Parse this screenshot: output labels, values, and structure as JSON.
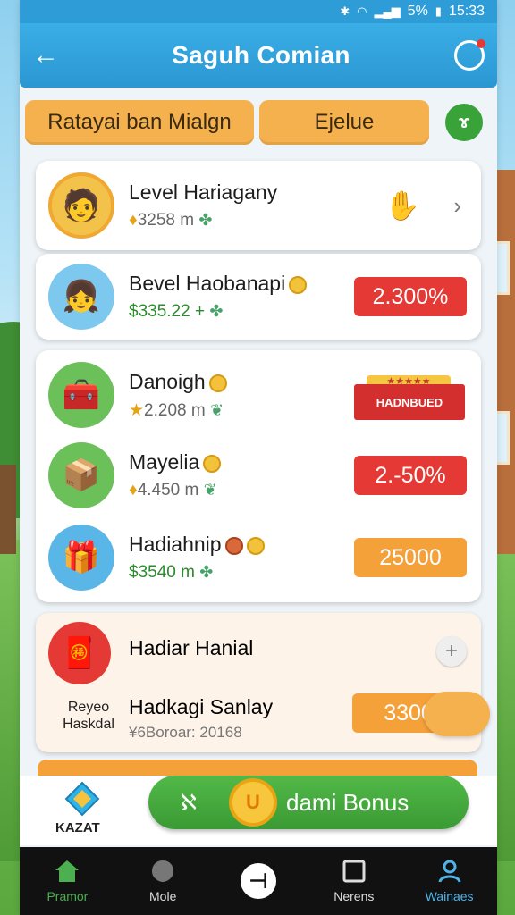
{
  "status_bar": {
    "battery": "5%",
    "time": "15:33"
  },
  "app_bar": {
    "title": "Saguh Comian"
  },
  "tabs": [
    {
      "label": "Ratayai ban Mialgn"
    },
    {
      "label": "Ejelue"
    }
  ],
  "tab_badge": "ɤ",
  "card1": {
    "name": "Level Hariagany",
    "sub": "3258 m"
  },
  "card2": {
    "name": "Bevel Haobanapi",
    "sub": "$335.22 +",
    "value": "2.300%"
  },
  "group": {
    "rows": [
      {
        "name": "Danoigh",
        "sub": "2.208 m",
        "badge": "HADNBUED",
        "stars": "★★★★★"
      },
      {
        "name": "Mayelia",
        "sub": "4.450 m",
        "value": "2.-50%"
      },
      {
        "name": "Hadiahnip",
        "sub": "$3540 m",
        "value": "25000"
      }
    ]
  },
  "bonus_card": {
    "title": "Hadiar Hanial",
    "avatar_caption": "Reyeo Haskdal",
    "name": "Hadkagi Sanlay",
    "sub": "¥6Boroar: 20168",
    "value": "3300",
    "plus": "+"
  },
  "cta_bar": {
    "store_label": "KAZAT",
    "x_label": "ℵ",
    "coin_text": "U",
    "button_label": "dami Bonus"
  },
  "nav": [
    {
      "label": "Pramor"
    },
    {
      "label": "Mole"
    },
    {
      "label": "⊣"
    },
    {
      "label": "Nerens"
    },
    {
      "label": "Wainaes"
    }
  ],
  "colors": {
    "primary": "#2e9cd6",
    "tab": "#f5b14e",
    "red": "#e53935",
    "orange": "#f5a13a",
    "green": "#3a9a34"
  }
}
